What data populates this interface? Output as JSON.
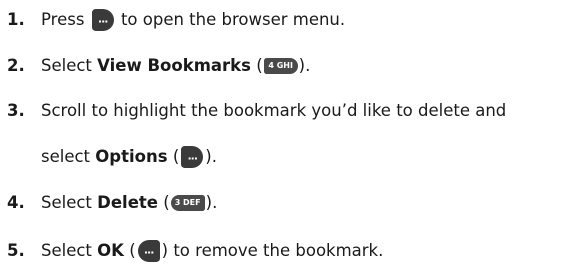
{
  "steps": [
    {
      "num": "1.",
      "pre": "Press",
      "post": "to open the browser menu."
    },
    {
      "num": "2.",
      "pre": "Select",
      "bold": "View Bookmarks",
      "paren_open": "(",
      "key": "4 GHI",
      "paren_close": ")."
    },
    {
      "num": "3.",
      "line1": "Scroll to highlight the bookmark you’d like to delete and",
      "pre": "select",
      "bold": "Options",
      "paren_open": "(",
      "paren_close": ")."
    },
    {
      "num": "4.",
      "pre": "Select",
      "bold": "Delete",
      "paren_open": "(",
      "key": "3 DEF",
      "paren_close": ")."
    },
    {
      "num": "5.",
      "pre": "Select",
      "bold": "OK",
      "paren_open": "(",
      "post": ") to remove the bookmark."
    }
  ]
}
